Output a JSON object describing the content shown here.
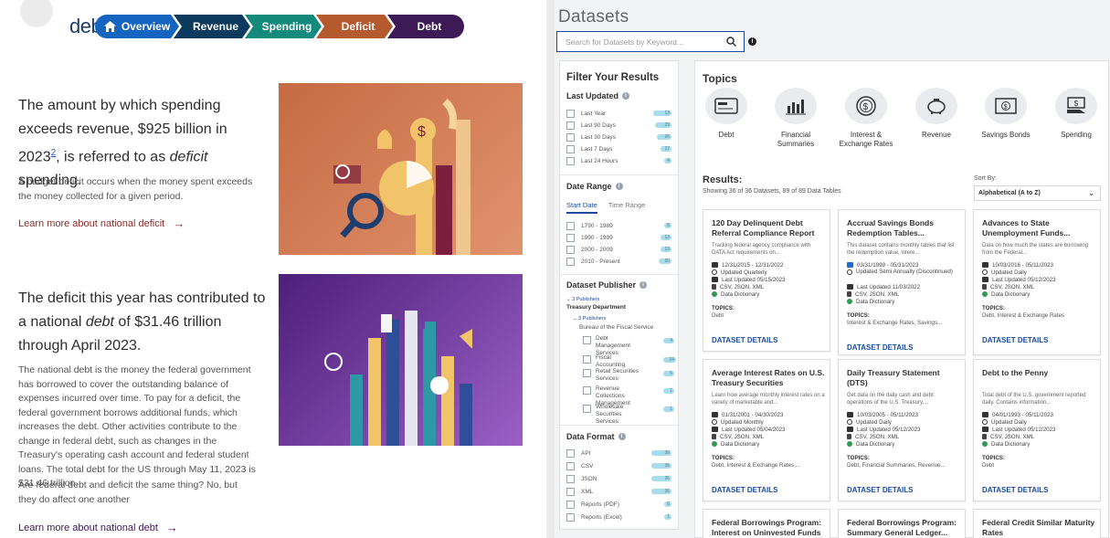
{
  "left": {
    "logo_text": "deb",
    "nav": [
      {
        "label": "Overview",
        "color": "#1565c0"
      },
      {
        "label": "Revenue",
        "color": "#0d3a5f"
      },
      {
        "label": "Spending",
        "color": "#138a7c"
      },
      {
        "label": "Deficit",
        "color": "#b5592f"
      },
      {
        "label": "Debt",
        "color": "#3d1a55"
      }
    ],
    "deficit": {
      "title_a": "The amount by which spending exceeds revenue, $925 billion in 2023",
      "title_sup": "2",
      "title_b": ", is referred to as ",
      "title_ital": "deficit",
      "title_c": " spending.",
      "body": "A budget deficit occurs when the money spent exceeds the money collected for a given period.",
      "link": "Learn more about national deficit"
    },
    "debt": {
      "title_a": "The deficit this year has contributed to a national ",
      "title_ital": "debt",
      "title_b": " of $31.46 trillion through April 2023.",
      "body1": "The national debt is the money the federal government has borrowed to cover the outstanding balance of expenses incurred over time. To pay for a deficit, the federal government borrows additional funds, which increases the debt. Other activities contribute to the change in federal debt, such as changes in the Treasury's operating cash account and federal student loans. The total debt for the US through May 11, 2023 is $31.46 trillion.",
      "body2": "Are federal debt and deficit the same thing? No, but they do affect one another",
      "link": "Learn more about national debt"
    }
  },
  "right": {
    "title": "Datasets",
    "search_placeholder": "Search for Datasets by Keyword...",
    "filter_title": "Filter Your Results",
    "last_updated": {
      "title": "Last Updated",
      "items": [
        {
          "label": "Last Year",
          "count": "13"
        },
        {
          "label": "Last 90 Days",
          "count": "29"
        },
        {
          "label": "Last 30 Days",
          "count": "26"
        },
        {
          "label": "Last 7 Days",
          "count": "17"
        },
        {
          "label": "Last 24 Hours",
          "count": "4"
        }
      ]
    },
    "date_range": {
      "title": "Date Range",
      "tab_start": "Start Date",
      "tab_time": "Time Range",
      "items": [
        {
          "label": "1790 - 1989",
          "count": "6"
        },
        {
          "label": "1990 - 1999",
          "count": "12"
        },
        {
          "label": "2000 - 2009",
          "count": "13"
        },
        {
          "label": "2010 - Present",
          "count": "20"
        }
      ]
    },
    "publisher": {
      "title": "Dataset Publisher",
      "count_note": "3 Publishers",
      "dept": "Treasury Department",
      "sub_count_note": "3 Publishers",
      "bureau": "Bureau of the Fiscal Service",
      "items": [
        {
          "label": "Debt Management Services",
          "count": "4"
        },
        {
          "label": "Fiscal Accounting",
          "count": "24"
        },
        {
          "label": "Retail Securities Services",
          "count": "6"
        },
        {
          "label": "Revenue Collections Management",
          "count": "1"
        },
        {
          "label": "Wholesale Securities Services",
          "count": "1"
        }
      ]
    },
    "data_format": {
      "title": "Data Format",
      "items": [
        {
          "label": "API",
          "count": "36"
        },
        {
          "label": "CSV",
          "count": "36"
        },
        {
          "label": "JSON",
          "count": "36"
        },
        {
          "label": "XML",
          "count": "36"
        },
        {
          "label": "Reports (PDF)",
          "count": "6"
        },
        {
          "label": "Reports (Excel)",
          "count": "1"
        }
      ]
    },
    "topics_title": "Topics",
    "topics": [
      {
        "label": "Debt"
      },
      {
        "label": "Financial Summaries"
      },
      {
        "label": "Interest & Exchange Rates"
      },
      {
        "label": "Revenue"
      },
      {
        "label": "Savings Bonds"
      },
      {
        "label": "Spending"
      }
    ],
    "results_title": "Results:",
    "results_sub": "Showing 36 of 36 Datasets, 89 of 89 Data Tables",
    "sort_label": "Sort By:",
    "sort_value": "Alphabetical (A to Z)",
    "details_label": "DATASET DETAILS",
    "topics_label": "TOPICS:",
    "cards": [
      {
        "title": "120 Day Delinquent Debt Referral Compliance Report",
        "desc": "Tracking federal agency compliance with DATA Act requirements on...",
        "dates": "12/31/2015 - 12/31/2022",
        "freq": "Updated Quarterly",
        "updated": "Last Updated 05/15/2023",
        "formats": "CSV, JSON, XML",
        "dict": "Data Dictionary",
        "topics": "Debt"
      },
      {
        "title": "Accrual Savings Bonds Redemption Tables...",
        "desc": "This dataset contains monthly tables that list the redemption value, intere...",
        "dates": "03/31/1999 - 05/31/2023",
        "freq": "Updated Semi Annually (Discontinued)",
        "updated": "Last Updated 11/03/2022",
        "formats": "CSV, JSON, XML",
        "dict": "Data Dictionary",
        "topics": "Interest & Exchange Rates, Savings..."
      },
      {
        "title": "Advances to State Unemployment Funds...",
        "desc": "Data on how much the states are borrowing from the Federal...",
        "dates": "10/03/2016 - 05/11/2023",
        "freq": "Updated Daily",
        "updated": "Last Updated 05/12/2023",
        "formats": "CSV, JSON, XML",
        "dict": "Data Dictionary",
        "topics": "Debt, Interest & Exchange Rates"
      },
      {
        "title": "Average Interest Rates on U.S. Treasury Securities",
        "desc": "Learn how average monthly interest rates on a variety of marketable and...",
        "dates": "01/31/2001 - 04/30/2023",
        "freq": "Updated Monthly",
        "updated": "Last Updated 05/04/2023",
        "formats": "CSV, JSON, XML",
        "dict": "Data Dictionary",
        "topics": "Debt, Interest & Exchange Rates,..."
      },
      {
        "title": "Daily Treasury Statement (DTS)",
        "desc": "Get data on the daily cash and debt operations of the U.S. Treasury,...",
        "dates": "10/03/2005 - 05/11/2023",
        "freq": "Updated Daily",
        "updated": "Last Updated 05/12/2023",
        "formats": "CSV, JSON, XML",
        "dict": "Data Dictionary",
        "topics": "Debt, Financial Summaries, Revenue..."
      },
      {
        "title": "Debt to the Penny",
        "desc": "Total debt of the U.S. government reported daily. Contains information...",
        "dates": "04/01/1993 - 05/11/2023",
        "freq": "Updated Daily",
        "updated": "Last Updated 05/12/2023",
        "formats": "CSV, JSON, XML",
        "dict": "Data Dictionary",
        "topics": "Debt"
      },
      {
        "title": "Federal Borrowings Program: Interest on Uninvested Funds"
      },
      {
        "title": "Federal Borrowings Program: Summary General Ledger..."
      },
      {
        "title": "Federal Credit Similar Maturity Rates"
      }
    ]
  }
}
